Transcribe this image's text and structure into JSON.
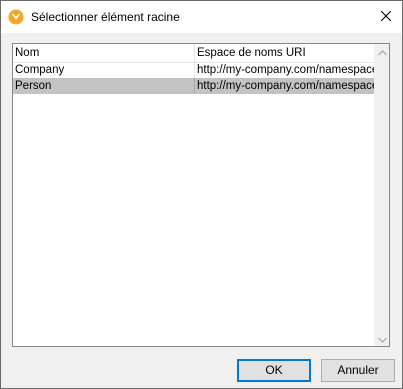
{
  "window": {
    "title": "Sélectionner élément racine",
    "icon": "altova-mapforce-icon",
    "close_icon": "close-icon"
  },
  "list": {
    "columns": [
      "Nom",
      "Espace de noms URI"
    ],
    "rows": [
      {
        "name": "Company",
        "namespace": "http://my-company.com/namespace",
        "selected": false
      },
      {
        "name": "Person",
        "namespace": "http://my-company.com/namespace",
        "selected": true
      }
    ]
  },
  "buttons": {
    "ok_label": "OK",
    "cancel_label": "Annuler"
  },
  "colors": {
    "selection": "#c3c3c3",
    "accent": "#0078d7",
    "icon_orange": "#f5a623"
  }
}
